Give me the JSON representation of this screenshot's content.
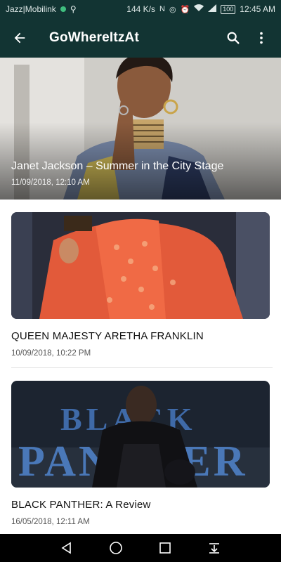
{
  "status_bar": {
    "carrier": "Jazz|Mobilink",
    "speed": "144 K/s",
    "battery": "100",
    "time": "12:45 AM"
  },
  "app_bar": {
    "title": "GoWhereItzAt"
  },
  "hero": {
    "title": "Janet Jackson – Summer in the City Stage",
    "date": "11/09/2018, 12:10 AM"
  },
  "articles": [
    {
      "title": "QUEEN MAJESTY ARETHA FRANKLIN",
      "date": "10/09/2018, 10:22 PM"
    },
    {
      "title": "BLACK PANTHER: A Review",
      "date": "16/05/2018, 12:11 AM",
      "image_text": [
        "BLACK",
        "PANTHER"
      ]
    }
  ],
  "colors": {
    "app_bar": "#123433",
    "nav_bar": "#000000"
  }
}
